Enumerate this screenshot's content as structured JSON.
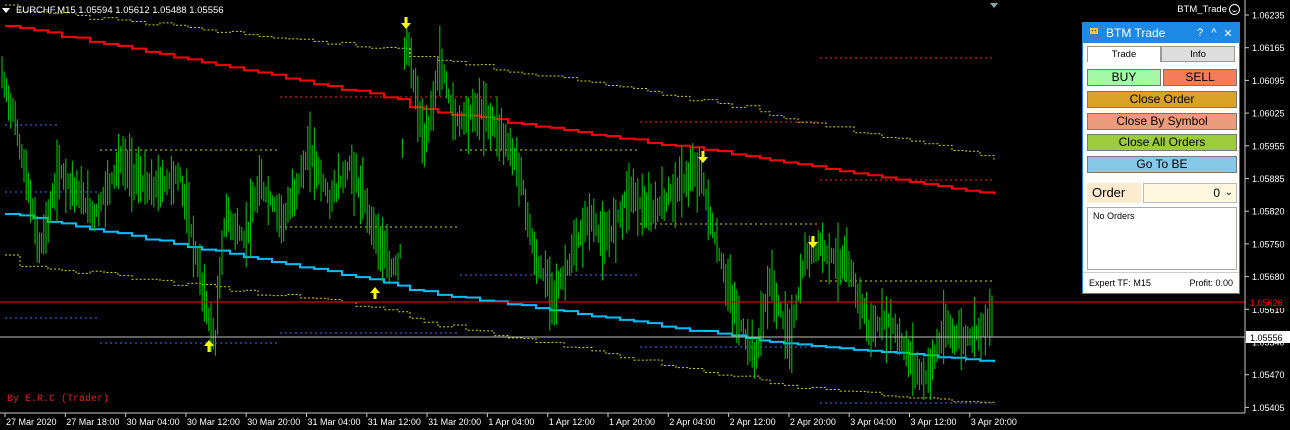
{
  "window": {
    "symbol_info": "EURCHF,M15  1.05594 1.05612 1.05488 1.05556",
    "ea_label": "BTM_Trade",
    "signature": "By E.R.C (Trader)"
  },
  "price_axis": {
    "ticks": [
      "1.06235",
      "1.06165",
      "1.06095",
      "1.06025",
      "1.05955",
      "1.05885",
      "1.05820",
      "1.05750",
      "1.05680",
      "1.05610",
      "1.05540",
      "1.05470",
      "1.05405"
    ],
    "current_price_tag": "1.05556",
    "red_line_tag": "1.05626"
  },
  "time_axis": {
    "ticks": [
      "27 Mar 2020",
      "27 Mar 18:00",
      "30 Mar 04:00",
      "30 Mar 12:00",
      "30 Mar 20:00",
      "31 Mar 04:00",
      "31 Mar 12:00",
      "31 Mar 20:00",
      "1 Apr 04:00",
      "1 Apr 12:00",
      "1 Apr 20:00",
      "2 Apr 04:00",
      "2 Apr 12:00",
      "2 Apr 20:00",
      "3 Apr 04:00",
      "3 Apr 12:00",
      "3 Apr 20:00"
    ]
  },
  "panel": {
    "title": "BTM Trade",
    "help": "?",
    "minimize": "^",
    "close": "✕",
    "tab_trade": "Trade",
    "tab_info": "Info",
    "buy": "BUY",
    "sell": "SELL",
    "close_order": "Close Order",
    "close_by_symbol": "Close By Symbol",
    "close_all_orders": "Close All Orders",
    "go_to_be": "Go To BE",
    "order_label": "Order",
    "order_value": "0",
    "orders_text": "No Orders",
    "expert_tf": "Expert TF: M15",
    "profit": "Profit: 0.00"
  },
  "colors": {
    "background": "#000000",
    "candles": "#00c000",
    "upper_band": "#ff0000",
    "lower_band": "#00bfff",
    "envelope": "#d4d400",
    "dotted_red": "#ff2020",
    "dotted_blue": "#3070ff",
    "arrows": "#ffff00",
    "buy": "#a4f7a4",
    "sell": "#f47b5c",
    "close_order": "#d9a227",
    "close_by_symbol": "#eb9c7a",
    "close_all_orders": "#9ccc3c",
    "go_to_be": "#87c8e8"
  },
  "chart_data": {
    "type": "line",
    "symbol": "EURCHF",
    "timeframe": "M15",
    "y_range": [
      1.05405,
      1.06235
    ],
    "series": [
      {
        "name": "",
        "x": [
          "27 Mar 2020",
          "27 Mar 18:00",
          "30 Mar 04:00",
          "30 Mar 12:00",
          "30 Mar 20:00",
          "31 Mar 04:00",
          "31 Mar 12:00",
          "31 Mar 20:00",
          "1 Apr 04:00",
          "1 Apr 12:00",
          "1 Apr 20:00",
          "2 Apr 04:00",
          "2 Apr 12:00",
          "2 Apr 20:00",
          "3 Apr 04:00",
          "3 Apr 12:00",
          "3 Apr 20:00"
        ],
        "values": [
          1.0602,
          1.0575,
          1.0585,
          1.0552,
          1.058,
          1.059,
          1.0565,
          1.0612,
          1.0598,
          1.0565,
          1.0575,
          1.0588,
          1.0535,
          1.0562,
          1.0555,
          1.0552,
          1.0556
        ]
      }
    ],
    "horizontal_lines": [
      1.05626,
      1.05556
    ]
  }
}
